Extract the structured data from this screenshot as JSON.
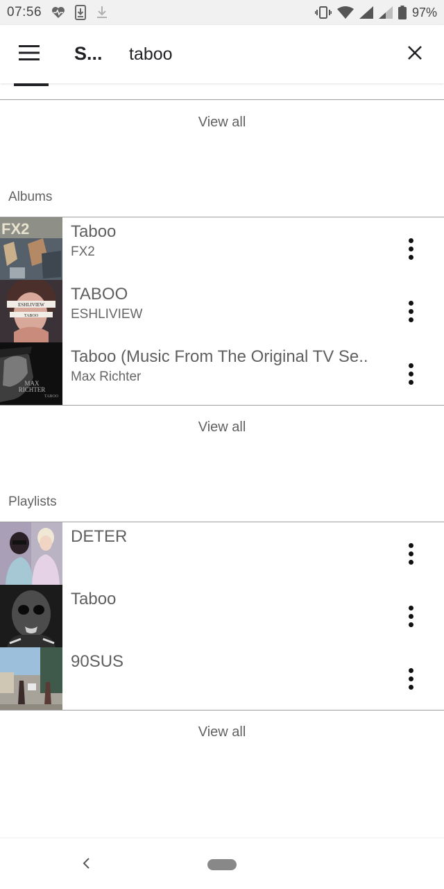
{
  "status_bar": {
    "time": "07:56",
    "battery": "97%",
    "icons": [
      "health-heart-icon",
      "download-box-icon",
      "download-arrow-icon",
      "vibrate-icon",
      "wifi-icon",
      "signal-icon",
      "signal-weak-icon",
      "battery-icon"
    ]
  },
  "app_bar": {
    "menu_icon": "hamburger-menu-icon",
    "title": "S...",
    "search_value": "taboo",
    "search_placeholder": "",
    "close_icon": "close-icon"
  },
  "sections": {
    "top": {
      "view_all": "View all"
    },
    "albums": {
      "header": "Albums",
      "items": [
        {
          "title": "Taboo",
          "subtitle": "FX2"
        },
        {
          "title": "TABOO",
          "subtitle": "ESHLIVIEW"
        },
        {
          "title": "Taboo (Music From The Original TV Se..",
          "subtitle": "Max Richter"
        }
      ],
      "view_all": "View all",
      "art_text": {
        "fx2": "FX2",
        "eshliview": "ESHLIVIEW",
        "taboo_small": "TABOO",
        "max_richter_1": "MAX",
        "max_richter_2": "RICHTER",
        "max_richter_3": "TABOO"
      }
    },
    "playlists": {
      "header": "Playlists",
      "items": [
        {
          "title": "DETER"
        },
        {
          "title": "Taboo"
        },
        {
          "title": "90SUS"
        }
      ],
      "view_all": "View all"
    }
  },
  "nav_bar": {
    "back_icon": "back-chevron-icon",
    "home_icon": "home-pill-icon"
  },
  "colors": {
    "text_primary": "#202124",
    "text_secondary": "#5f5f5f",
    "divider": "#9e9e9e",
    "status_bar_bg": "#f1f1f1"
  }
}
